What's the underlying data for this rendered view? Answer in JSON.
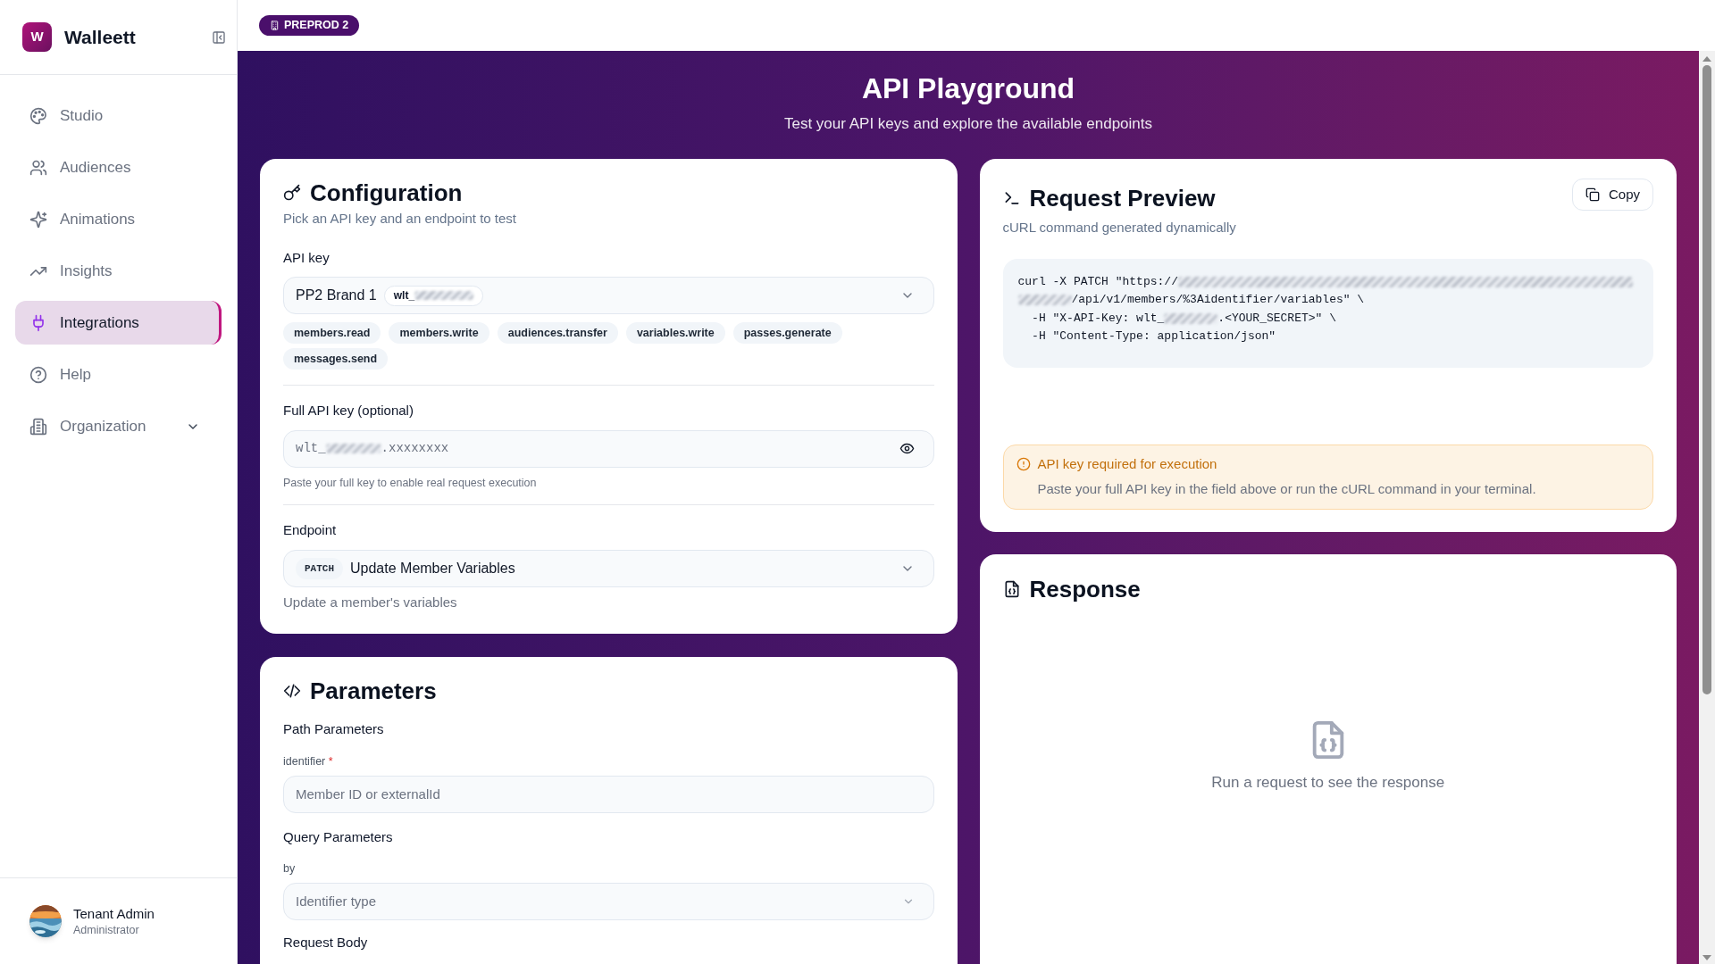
{
  "sidebar": {
    "logo_letter": "W",
    "app_name": "Walleett",
    "items": [
      {
        "label": "Studio",
        "kind": "link",
        "selected": false
      },
      {
        "label": "Audiences",
        "kind": "link",
        "selected": false
      },
      {
        "label": "Animations",
        "kind": "link",
        "selected": false
      },
      {
        "label": "Insights",
        "kind": "link",
        "selected": false
      },
      {
        "label": "Integrations",
        "kind": "link",
        "selected": true
      },
      {
        "label": "Help",
        "kind": "link",
        "selected": false
      },
      {
        "label": "Organization",
        "kind": "group",
        "selected": false
      }
    ],
    "user": {
      "name": "Tenant Admin",
      "role": "Administrator"
    }
  },
  "environment_badge": "PREPROD 2",
  "header": {
    "title": "API Playground",
    "subtitle": "Test your API keys and explore the available endpoints"
  },
  "configuration": {
    "title": "Configuration",
    "subtitle": "Pick an API key and an endpoint to test",
    "api_key": {
      "label": "API key",
      "value": "PP2 Brand 1",
      "key_prefix": "wlt_"
    },
    "scopes": [
      "members.read",
      "members.write",
      "audiences.transfer",
      "variables.write",
      "passes.generate",
      "messages.send"
    ],
    "full_key": {
      "label": "Full API key (optional)",
      "prefix": "wlt_",
      "suffix": ".xxxxxxxx",
      "hint": "Paste your full key to enable real request execution"
    },
    "endpoint": {
      "label": "Endpoint",
      "method": "PATCH",
      "name": "Update Member Variables",
      "description": "Update a member's variables"
    }
  },
  "parameters": {
    "title": "Parameters",
    "path_heading": "Path Parameters",
    "identifier": {
      "label": "identifier",
      "required_mark": "*",
      "placeholder": "Member ID or externalId"
    },
    "query_heading": "Query Parameters",
    "by": {
      "label": "by",
      "placeholder": "Identifier type"
    },
    "body_heading": "Request Body"
  },
  "request_preview": {
    "title": "Request Preview",
    "subtitle": "cURL command generated dynamically",
    "copy_button": "Copy",
    "code_lines": [
      [
        {
          "kind": "text",
          "text": "curl -X PATCH \"https://"
        },
        {
          "kind": "redacted"
        }
      ],
      [
        {
          "kind": "redacted"
        },
        {
          "kind": "text",
          "text": "/api/v1/members/%3Aidentifier/variables\" \\"
        }
      ],
      [
        {
          "kind": "text",
          "text": "  -H \"X-API-Key: wlt_"
        },
        {
          "kind": "redacted"
        },
        {
          "kind": "text",
          "text": ".<YOUR_SECRET>\" \\"
        }
      ],
      [
        {
          "kind": "text",
          "text": "  -H \"Content-Type: application/json\""
        }
      ]
    ],
    "warning": {
      "title": "API key required for execution",
      "message": "Paste your full API key in the field above or run the cURL command in your terminal."
    }
  },
  "response": {
    "title": "Response",
    "empty_message": "Run a request to see the response"
  }
}
